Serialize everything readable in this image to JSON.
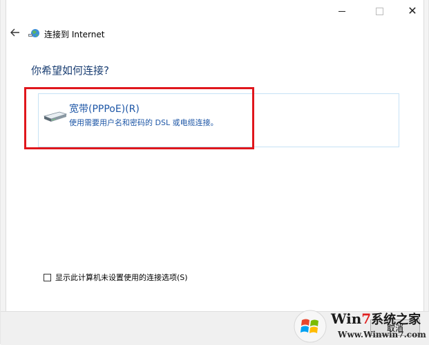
{
  "window": {
    "title": "连接到 Internet",
    "caption": {
      "minimize": "minimize",
      "maximize": "maximize",
      "close": "✕"
    }
  },
  "heading": "你希望如何连接?",
  "option": {
    "title": "宽带(PPPoE)(R)",
    "description": "使用需要用户名和密码的 DSL 或电缆连接。"
  },
  "checkbox": {
    "label": "显示此计算机未设置使用的连接选项(S)",
    "checked": false
  },
  "footer": {
    "cancel_label": "取消"
  },
  "watermark": {
    "brand_win": "Win",
    "brand_7": "7",
    "brand_cn": "系统之家",
    "url": "Www.Winwin7.com"
  },
  "colors": {
    "heading": "#1a3e72",
    "link": "#1d56a6",
    "highlight": "#e0161c"
  }
}
